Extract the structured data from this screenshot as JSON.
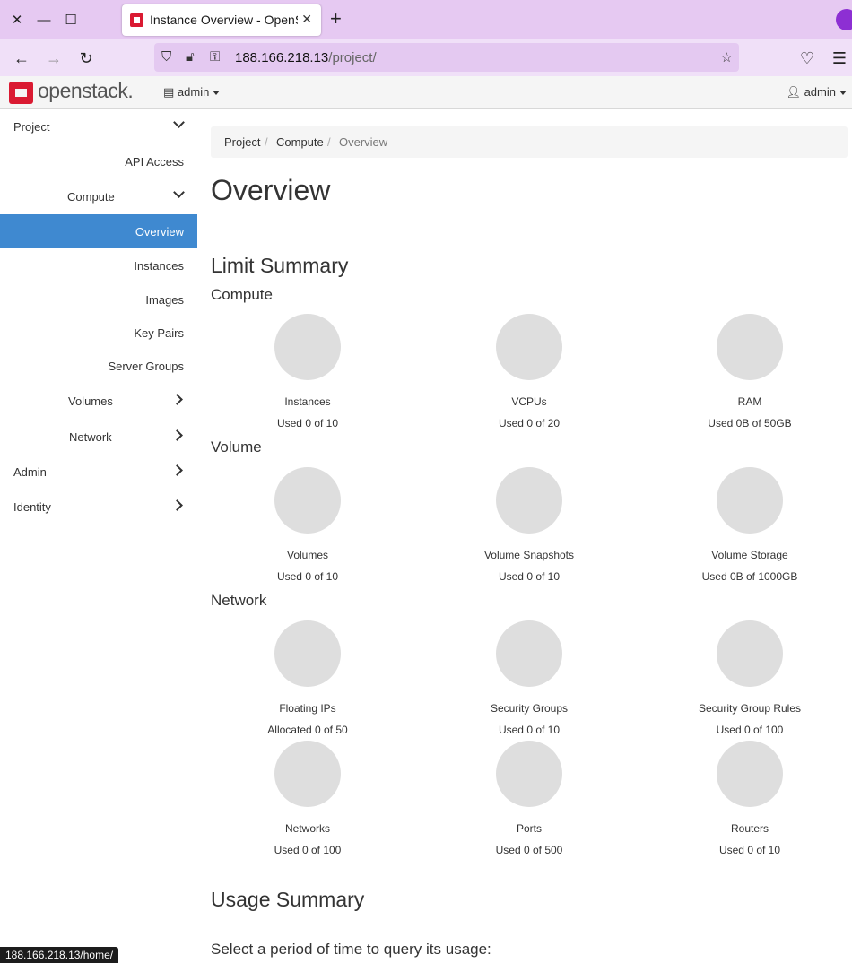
{
  "browser": {
    "tab_title": "Instance Overview - OpenStack Dashboard",
    "tab_close": "✕",
    "new_tab": "+",
    "url_host": "188.166.218.13",
    "url_path": "/project/",
    "status_url": "188.166.218.13/home/"
  },
  "header": {
    "logo_text": "openstack.",
    "project_label": "admin",
    "user_label": "admin"
  },
  "sidebar": {
    "project": "Project",
    "api_access": "API Access",
    "compute": "Compute",
    "overview": "Overview",
    "instances": "Instances",
    "images": "Images",
    "key_pairs": "Key Pairs",
    "server_groups": "Server Groups",
    "volumes": "Volumes",
    "network": "Network",
    "admin": "Admin",
    "identity": "Identity"
  },
  "breadcrumb": [
    "Project",
    "Compute",
    "Overview"
  ],
  "breadcrumb_sep": "/",
  "page_title": "Overview",
  "limit_summary": {
    "title": "Limit Summary",
    "compute": {
      "heading": "Compute",
      "items": [
        {
          "name": "Instances",
          "used": "Used 0 of 10"
        },
        {
          "name": "VCPUs",
          "used": "Used 0 of 20"
        },
        {
          "name": "RAM",
          "used": "Used 0B of 50GB"
        }
      ]
    },
    "volume": {
      "heading": "Volume",
      "items": [
        {
          "name": "Volumes",
          "used": "Used 0 of 10"
        },
        {
          "name": "Volume Snapshots",
          "used": "Used 0 of 10"
        },
        {
          "name": "Volume Storage",
          "used": "Used 0B of 1000GB"
        }
      ]
    },
    "network": {
      "heading": "Network",
      "items": [
        {
          "name": "Floating IPs",
          "used": "Allocated 0 of 50"
        },
        {
          "name": "Security Groups",
          "used": "Used 0 of 10"
        },
        {
          "name": "Security Group Rules",
          "used": "Used 0 of 100"
        },
        {
          "name": "Networks",
          "used": "Used 0 of 100"
        },
        {
          "name": "Ports",
          "used": "Used 0 of 500"
        },
        {
          "name": "Routers",
          "used": "Used 0 of 10"
        }
      ]
    }
  },
  "usage_summary": {
    "title": "Usage Summary",
    "prompt": "Select a period of time to query its usage:"
  },
  "colors": {
    "active_nav": "#3f89d0",
    "brand_red": "#da1a32",
    "pie_gray": "#dedede",
    "browser_chrome": "#e6c9f2"
  }
}
